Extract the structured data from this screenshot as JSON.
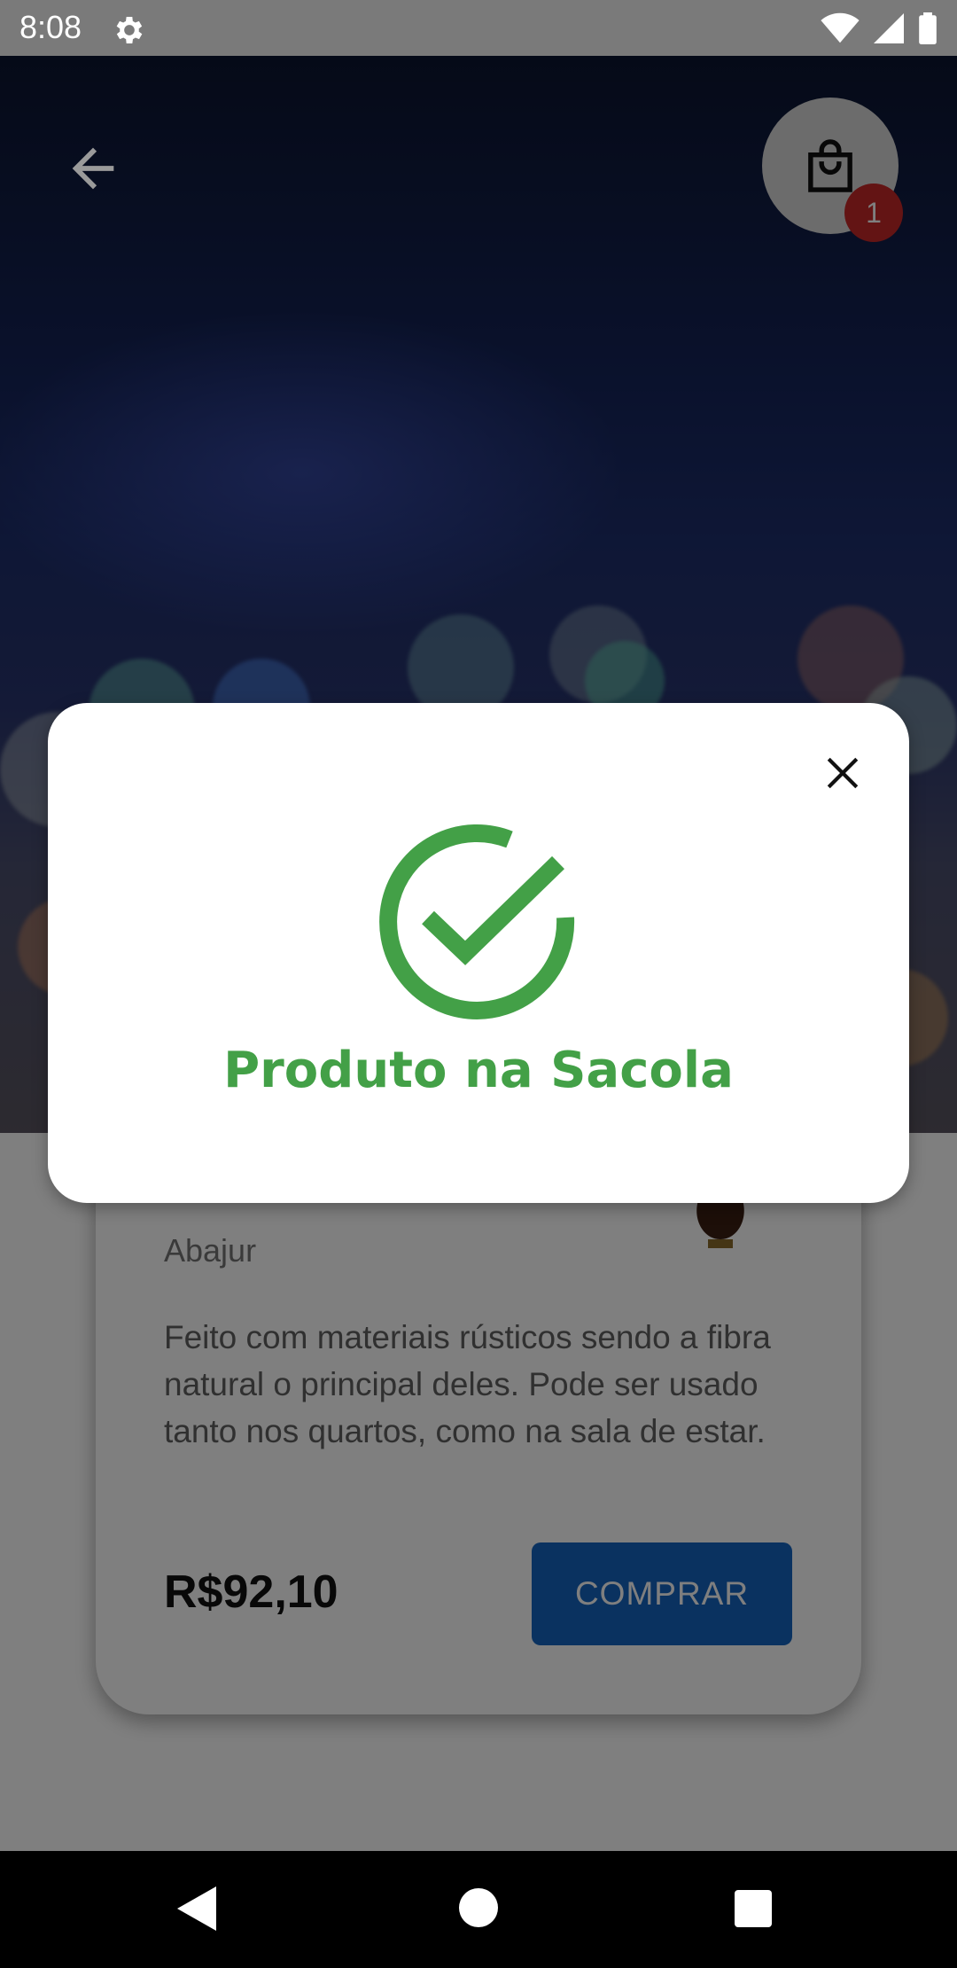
{
  "status_bar": {
    "time": "8:08",
    "icons": [
      "settings-icon",
      "wifi-icon",
      "signal-icon",
      "battery-icon"
    ]
  },
  "header": {
    "back_icon": "arrow-back-icon",
    "cart_icon": "shopping-bag-icon",
    "cart_count": "1"
  },
  "product": {
    "name": "Abajur",
    "description": "Feito com materiais rústicos sendo a fibra natural o principal deles. Pode ser usado tanto nos quartos, como na sala de estar.",
    "price": "R$92,10",
    "buy_label": "COMPRAR"
  },
  "dialog": {
    "title": "Produto na Sacola",
    "icon": "check-circle-icon",
    "close_icon": "close-icon"
  },
  "colors": {
    "accent_green": "#43a047",
    "buy_button": "#1565c0",
    "badge": "#c62828"
  }
}
